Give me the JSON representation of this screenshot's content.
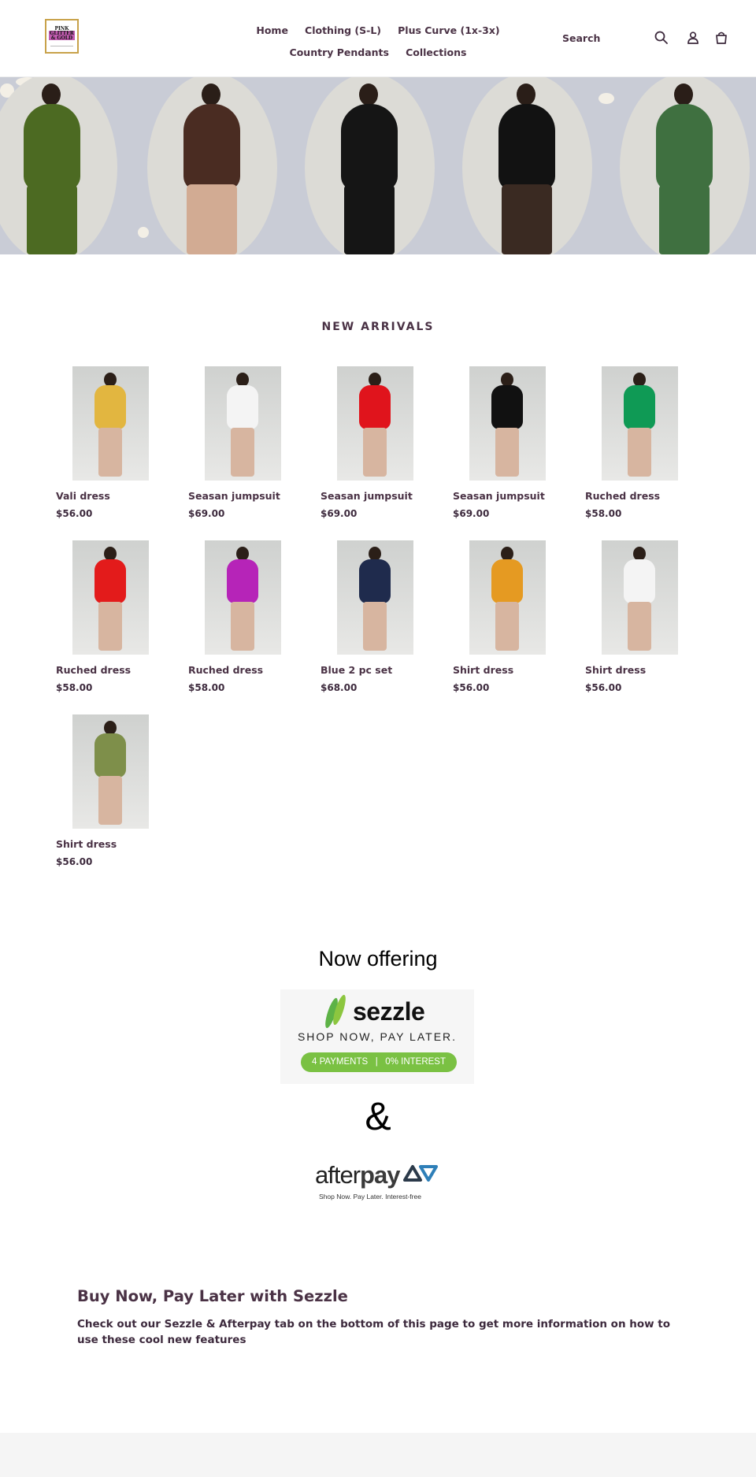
{
  "header": {
    "logo_text": [
      "PINK",
      "GLITTER",
      "& GOLD"
    ],
    "nav": [
      {
        "label": "Home"
      },
      {
        "label": "Clothing (S-L)"
      },
      {
        "label": "Plus Curve (1x-3x)"
      },
      {
        "label": "Country Pendants"
      },
      {
        "label": "Collections"
      }
    ],
    "search_label": "Search",
    "icons": [
      "search-icon",
      "account-icon",
      "cart-icon"
    ]
  },
  "hero": {
    "outfits": [
      {
        "color": "#4c6a22",
        "legs": "#4c6a22"
      },
      {
        "color": "#4a2c22",
        "legs": "#d2ab93"
      },
      {
        "color": "#151515",
        "legs": "#151515"
      },
      {
        "color": "#121212",
        "legs": "#3a2a22"
      },
      {
        "color": "#3f7040",
        "legs": "#3f7040"
      }
    ]
  },
  "new_arrivals": {
    "title": "NEW ARRIVALS",
    "products": [
      {
        "name": "Vali dress",
        "price": "$56.00",
        "color": "#e2b640"
      },
      {
        "name": "Seasan jumpsuit",
        "price": "$69.00",
        "color": "#f4f4f4"
      },
      {
        "name": "Seasan jumpsuit",
        "price": "$69.00",
        "color": "#e0141c"
      },
      {
        "name": "Seasan jumpsuit",
        "price": "$69.00",
        "color": "#111111"
      },
      {
        "name": "Ruched dress",
        "price": "$58.00",
        "color": "#0f9a55"
      },
      {
        "name": "Ruched dress",
        "price": "$58.00",
        "color": "#e31b1b"
      },
      {
        "name": "Ruched dress",
        "price": "$58.00",
        "color": "#b624b8"
      },
      {
        "name": "Blue 2 pc set",
        "price": "$68.00",
        "color": "#1f2b4d"
      },
      {
        "name": "Shirt dress",
        "price": "$56.00",
        "color": "#e59a22"
      },
      {
        "name": "Shirt dress",
        "price": "$56.00",
        "color": "#f4f4f4"
      },
      {
        "name": "Shirt dress",
        "price": "$56.00",
        "color": "#7e8f4a"
      }
    ]
  },
  "offering": {
    "title": "Now offering",
    "sezzle_word": "sezzle",
    "sezzle_tagline": "SHOP NOW, PAY LATER.",
    "sezzle_pill": "4 PAYMENTS   |   0% INTEREST",
    "ampersand": "&",
    "afterpay_word_light": "after",
    "afterpay_word_bold": "pay",
    "afterpay_tagline": "Shop Now. Pay Later. Interest-free"
  },
  "info": {
    "title": "Buy Now, Pay Later with Sezzle",
    "body": "Check out our Sezzle & Afterpay tab on the bottom of this page to get more information on how to use these cool new features"
  },
  "colors": {
    "text_plum": "#4a3245",
    "hero_bg": "#c9ccd6",
    "sezzle_green": "#7ac143",
    "afterpay_blue": "#2e7fb8"
  }
}
